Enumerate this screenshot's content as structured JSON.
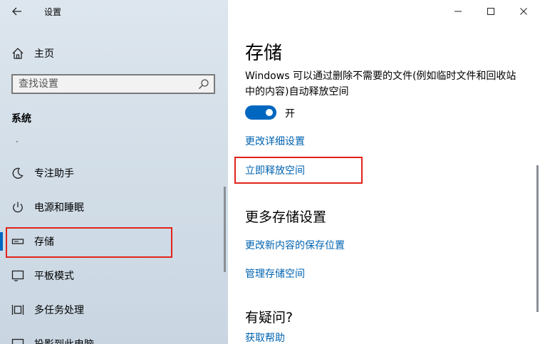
{
  "window": {
    "title": "设置"
  },
  "sidebar": {
    "home_label": "主页",
    "search_placeholder": "查找设置",
    "section_title": "系统",
    "dot": "·",
    "items": [
      {
        "label": "专注助手",
        "icon": "moon-icon"
      },
      {
        "label": "电源和睡眠",
        "icon": "power-icon"
      },
      {
        "label": "存储",
        "icon": "storage-drive-icon",
        "selected": true
      },
      {
        "label": "平板模式",
        "icon": "tablet-mode-icon"
      },
      {
        "label": "多任务处理",
        "icon": "multitasking-icon"
      },
      {
        "label": "投影到此电脑",
        "icon": "project-icon"
      }
    ]
  },
  "main": {
    "title": "存储",
    "description": "Windows 可以通过删除不需要的文件(例如临时文件和回收站中的内容)自动释放空间",
    "toggle": {
      "state_label": "开",
      "on": true
    },
    "links": {
      "change_settings": "更改详细设置",
      "free_up_now": "立即释放空间"
    },
    "more_settings_title": "更多存储设置",
    "more_links": {
      "change_save_location": "更改新内容的保存位置",
      "manage_spaces": "管理存储空间"
    },
    "question_title": "有疑问?",
    "help_link": "获取帮助"
  },
  "colors": {
    "accent": "#0067c0",
    "link": "#0063b1",
    "highlight_box": "#e2231a"
  }
}
